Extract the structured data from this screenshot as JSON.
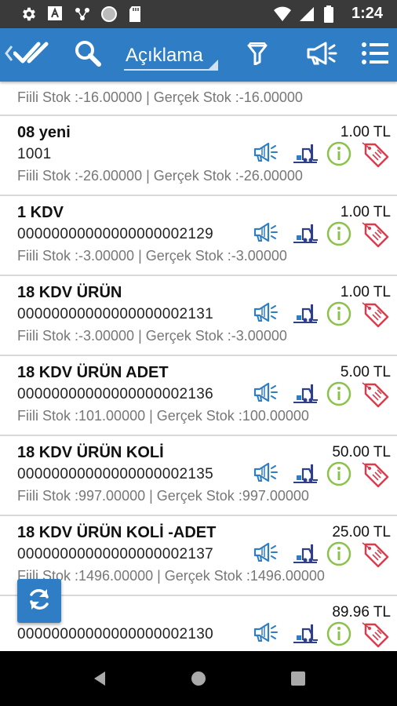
{
  "status_bar": {
    "time": "1:24",
    "left_icons": [
      "gear-icon",
      "text-a-icon",
      "share-dots-icon",
      "circle-icon",
      "sd-card-icon"
    ],
    "right_icons": [
      "wifi-icon",
      "signal-icon",
      "battery-icon"
    ]
  },
  "toolbar": {
    "back_icon": "chevron-left-icon",
    "select_all_icon": "double-check-icon",
    "search_icon": "search-icon",
    "field_dropdown": {
      "selected": "Açıklama"
    },
    "filter_icon": "filter-icon",
    "announce_icon": "megaphone-icon",
    "menu_icon": "list-menu-icon",
    "color": "#2f7dc5"
  },
  "products": [
    {
      "name": "",
      "code": "",
      "price": "",
      "stock": "Fiili Stok :-16.00000 | Gerçek Stok :-16.00000"
    },
    {
      "name": "08 yeni",
      "code": "1001",
      "price": "1.00 TL",
      "stock": "Fiili Stok :-26.00000 | Gerçek Stok :-26.00000"
    },
    {
      "name": "1 KDV",
      "code": "00000000000000000002129",
      "price": "1.00 TL",
      "stock": "Fiili Stok :-3.00000 | Gerçek Stok :-3.00000"
    },
    {
      "name": "18 KDV ÜRÜN",
      "code": "00000000000000000002131",
      "price": "1.00 TL",
      "stock": "Fiili Stok :-3.00000 | Gerçek Stok :-3.00000"
    },
    {
      "name": "18 KDV ÜRÜN ADET",
      "code": "00000000000000000002136",
      "price": "5.00 TL",
      "stock": "Fiili Stok :101.00000 | Gerçek Stok :100.00000"
    },
    {
      "name": "18 KDV ÜRÜN KOLİ",
      "code": "00000000000000000002135",
      "price": "50.00 TL",
      "stock": "Fiili Stok :997.00000 | Gerçek Stok :997.00000"
    },
    {
      "name": "18 KDV ÜRÜN KOLİ -ADET",
      "code": "00000000000000000002137",
      "price": "25.00 TL",
      "stock": "Fiili Stok :1496.00000 | Gerçek Stok :1496.00000"
    },
    {
      "name": "",
      "code": "00000000000000000002130",
      "price": "89.96 TL",
      "stock": ""
    }
  ],
  "row_icons": [
    "megaphone-icon",
    "forklift-icon",
    "info-icon",
    "price-tag-icon"
  ],
  "fab_icon": "refresh-icon",
  "nav_bar": [
    "back-triangle-icon",
    "home-circle-icon",
    "recents-square-icon"
  ],
  "colors": {
    "icon_blue": "#2f7dc5",
    "icon_navy": "#2d3e8c",
    "info_green": "#8bc34a",
    "tag_red": "#e0394a"
  }
}
